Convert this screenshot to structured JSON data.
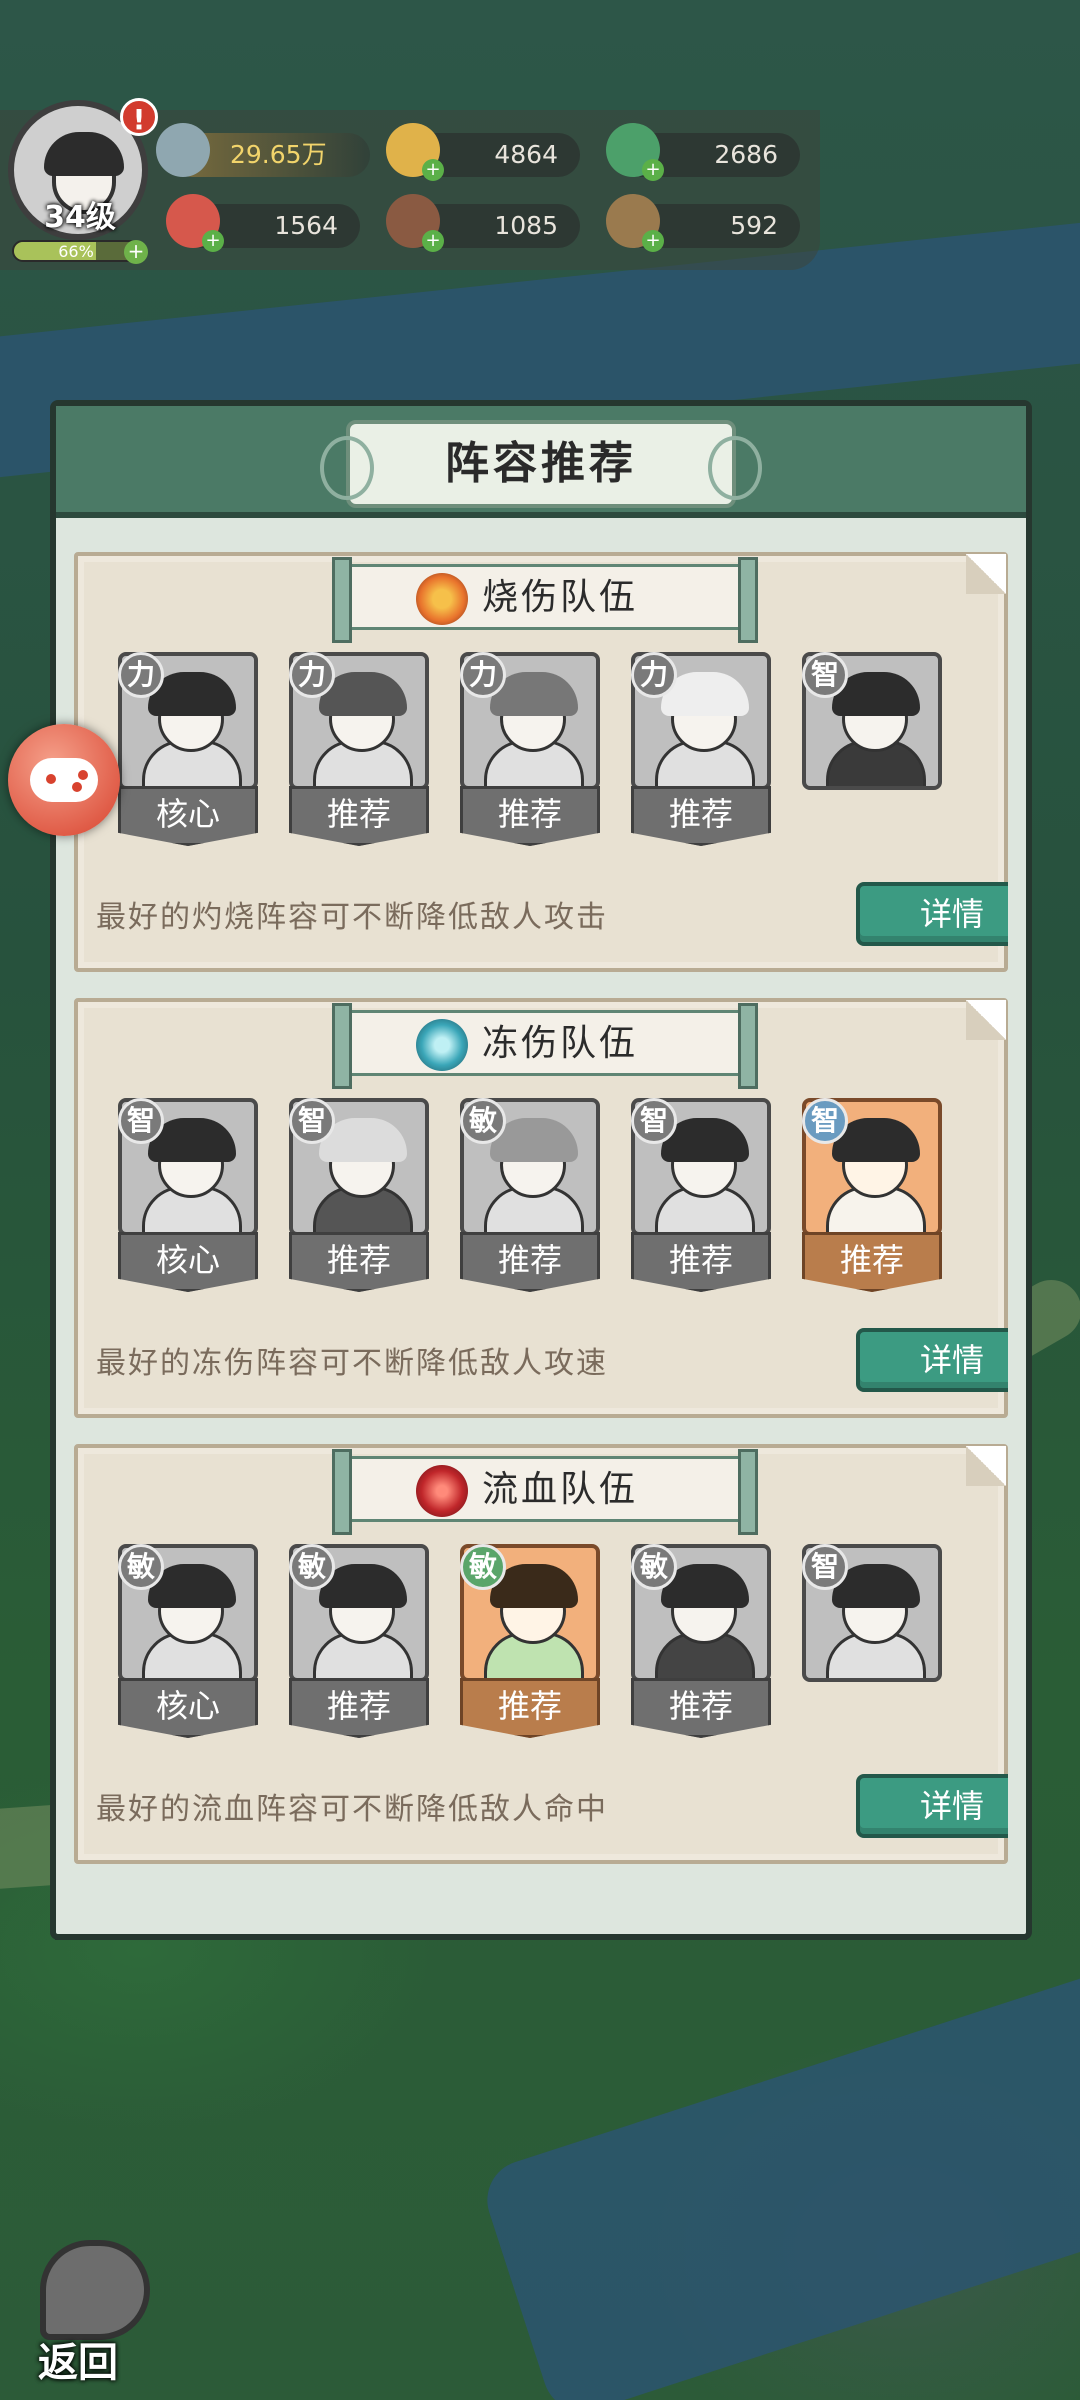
{
  "player": {
    "level": "34级",
    "exp_text": "66%",
    "exp_fraction": 0.66,
    "alert": "!"
  },
  "resources": {
    "power": "29.65万",
    "gold": "4864",
    "jade": "2686",
    "meat": "1564",
    "wood": "1085",
    "ore": "592"
  },
  "panel": {
    "title": "阵容推荐"
  },
  "teams": [
    {
      "name": "烧伤队伍",
      "icon": "fire-icon",
      "icon_color": "#e8722c",
      "heroes": [
        {
          "attr": "力",
          "tag": "核心",
          "style": "gray"
        },
        {
          "attr": "力",
          "tag": "推荐",
          "style": "gray"
        },
        {
          "attr": "力",
          "tag": "推荐",
          "style": "gray"
        },
        {
          "attr": "力",
          "tag": "推荐",
          "style": "gray"
        },
        {
          "attr": "智",
          "tag": "",
          "style": "gray"
        }
      ],
      "description": "最好的灼烧阵容可不断降低敌人攻击",
      "detail_label": "详情"
    },
    {
      "name": "冻伤队伍",
      "icon": "snowflake-icon",
      "icon_color": "#3aa6b8",
      "heroes": [
        {
          "attr": "智",
          "tag": "核心",
          "style": "gray"
        },
        {
          "attr": "智",
          "tag": "推荐",
          "style": "gray"
        },
        {
          "attr": "敏",
          "tag": "推荐",
          "style": "gray"
        },
        {
          "attr": "智",
          "tag": "推荐",
          "style": "gray"
        },
        {
          "attr": "智",
          "tag": "推荐",
          "style": "gold"
        }
      ],
      "description": "最好的冻伤阵容可不断降低敌人攻速",
      "detail_label": "详情"
    },
    {
      "name": "流血队伍",
      "icon": "blood-drop-icon",
      "icon_color": "#c0262a",
      "heroes": [
        {
          "attr": "敏",
          "tag": "核心",
          "style": "gray"
        },
        {
          "attr": "敏",
          "tag": "推荐",
          "style": "gray"
        },
        {
          "attr": "敏",
          "tag": "推荐",
          "style": "gold"
        },
        {
          "attr": "敏",
          "tag": "推荐",
          "style": "gray"
        },
        {
          "attr": "智",
          "tag": "",
          "style": "gray"
        }
      ],
      "description": "最好的流血阵容可不断降低敌人命中",
      "detail_label": "详情"
    }
  ],
  "back_label": "返回"
}
